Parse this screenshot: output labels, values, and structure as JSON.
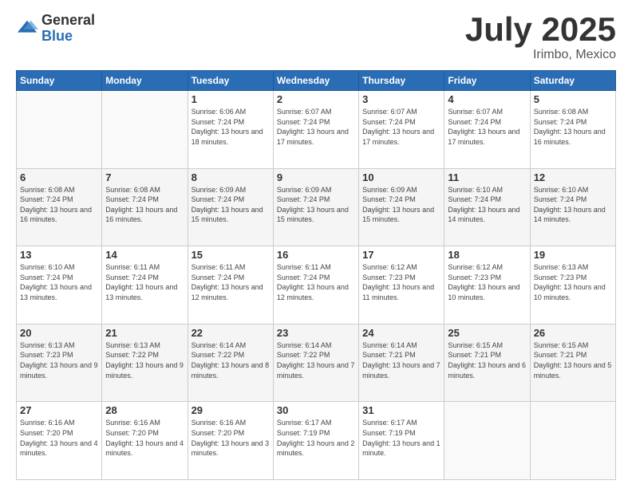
{
  "logo": {
    "general": "General",
    "blue": "Blue"
  },
  "title": {
    "month_year": "July 2025",
    "location": "Irimbo, Mexico"
  },
  "days_of_week": [
    "Sunday",
    "Monday",
    "Tuesday",
    "Wednesday",
    "Thursday",
    "Friday",
    "Saturday"
  ],
  "weeks": [
    [
      {
        "day": "",
        "info": ""
      },
      {
        "day": "",
        "info": ""
      },
      {
        "day": "1",
        "info": "Sunrise: 6:06 AM\nSunset: 7:24 PM\nDaylight: 13 hours and 18 minutes."
      },
      {
        "day": "2",
        "info": "Sunrise: 6:07 AM\nSunset: 7:24 PM\nDaylight: 13 hours and 17 minutes."
      },
      {
        "day": "3",
        "info": "Sunrise: 6:07 AM\nSunset: 7:24 PM\nDaylight: 13 hours and 17 minutes."
      },
      {
        "day": "4",
        "info": "Sunrise: 6:07 AM\nSunset: 7:24 PM\nDaylight: 13 hours and 17 minutes."
      },
      {
        "day": "5",
        "info": "Sunrise: 6:08 AM\nSunset: 7:24 PM\nDaylight: 13 hours and 16 minutes."
      }
    ],
    [
      {
        "day": "6",
        "info": "Sunrise: 6:08 AM\nSunset: 7:24 PM\nDaylight: 13 hours and 16 minutes."
      },
      {
        "day": "7",
        "info": "Sunrise: 6:08 AM\nSunset: 7:24 PM\nDaylight: 13 hours and 16 minutes."
      },
      {
        "day": "8",
        "info": "Sunrise: 6:09 AM\nSunset: 7:24 PM\nDaylight: 13 hours and 15 minutes."
      },
      {
        "day": "9",
        "info": "Sunrise: 6:09 AM\nSunset: 7:24 PM\nDaylight: 13 hours and 15 minutes."
      },
      {
        "day": "10",
        "info": "Sunrise: 6:09 AM\nSunset: 7:24 PM\nDaylight: 13 hours and 15 minutes."
      },
      {
        "day": "11",
        "info": "Sunrise: 6:10 AM\nSunset: 7:24 PM\nDaylight: 13 hours and 14 minutes."
      },
      {
        "day": "12",
        "info": "Sunrise: 6:10 AM\nSunset: 7:24 PM\nDaylight: 13 hours and 14 minutes."
      }
    ],
    [
      {
        "day": "13",
        "info": "Sunrise: 6:10 AM\nSunset: 7:24 PM\nDaylight: 13 hours and 13 minutes."
      },
      {
        "day": "14",
        "info": "Sunrise: 6:11 AM\nSunset: 7:24 PM\nDaylight: 13 hours and 13 minutes."
      },
      {
        "day": "15",
        "info": "Sunrise: 6:11 AM\nSunset: 7:24 PM\nDaylight: 13 hours and 12 minutes."
      },
      {
        "day": "16",
        "info": "Sunrise: 6:11 AM\nSunset: 7:24 PM\nDaylight: 13 hours and 12 minutes."
      },
      {
        "day": "17",
        "info": "Sunrise: 6:12 AM\nSunset: 7:23 PM\nDaylight: 13 hours and 11 minutes."
      },
      {
        "day": "18",
        "info": "Sunrise: 6:12 AM\nSunset: 7:23 PM\nDaylight: 13 hours and 10 minutes."
      },
      {
        "day": "19",
        "info": "Sunrise: 6:13 AM\nSunset: 7:23 PM\nDaylight: 13 hours and 10 minutes."
      }
    ],
    [
      {
        "day": "20",
        "info": "Sunrise: 6:13 AM\nSunset: 7:23 PM\nDaylight: 13 hours and 9 minutes."
      },
      {
        "day": "21",
        "info": "Sunrise: 6:13 AM\nSunset: 7:22 PM\nDaylight: 13 hours and 9 minutes."
      },
      {
        "day": "22",
        "info": "Sunrise: 6:14 AM\nSunset: 7:22 PM\nDaylight: 13 hours and 8 minutes."
      },
      {
        "day": "23",
        "info": "Sunrise: 6:14 AM\nSunset: 7:22 PM\nDaylight: 13 hours and 7 minutes."
      },
      {
        "day": "24",
        "info": "Sunrise: 6:14 AM\nSunset: 7:21 PM\nDaylight: 13 hours and 7 minutes."
      },
      {
        "day": "25",
        "info": "Sunrise: 6:15 AM\nSunset: 7:21 PM\nDaylight: 13 hours and 6 minutes."
      },
      {
        "day": "26",
        "info": "Sunrise: 6:15 AM\nSunset: 7:21 PM\nDaylight: 13 hours and 5 minutes."
      }
    ],
    [
      {
        "day": "27",
        "info": "Sunrise: 6:16 AM\nSunset: 7:20 PM\nDaylight: 13 hours and 4 minutes."
      },
      {
        "day": "28",
        "info": "Sunrise: 6:16 AM\nSunset: 7:20 PM\nDaylight: 13 hours and 4 minutes."
      },
      {
        "day": "29",
        "info": "Sunrise: 6:16 AM\nSunset: 7:20 PM\nDaylight: 13 hours and 3 minutes."
      },
      {
        "day": "30",
        "info": "Sunrise: 6:17 AM\nSunset: 7:19 PM\nDaylight: 13 hours and 2 minutes."
      },
      {
        "day": "31",
        "info": "Sunrise: 6:17 AM\nSunset: 7:19 PM\nDaylight: 13 hours and 1 minute."
      },
      {
        "day": "",
        "info": ""
      },
      {
        "day": "",
        "info": ""
      }
    ]
  ]
}
